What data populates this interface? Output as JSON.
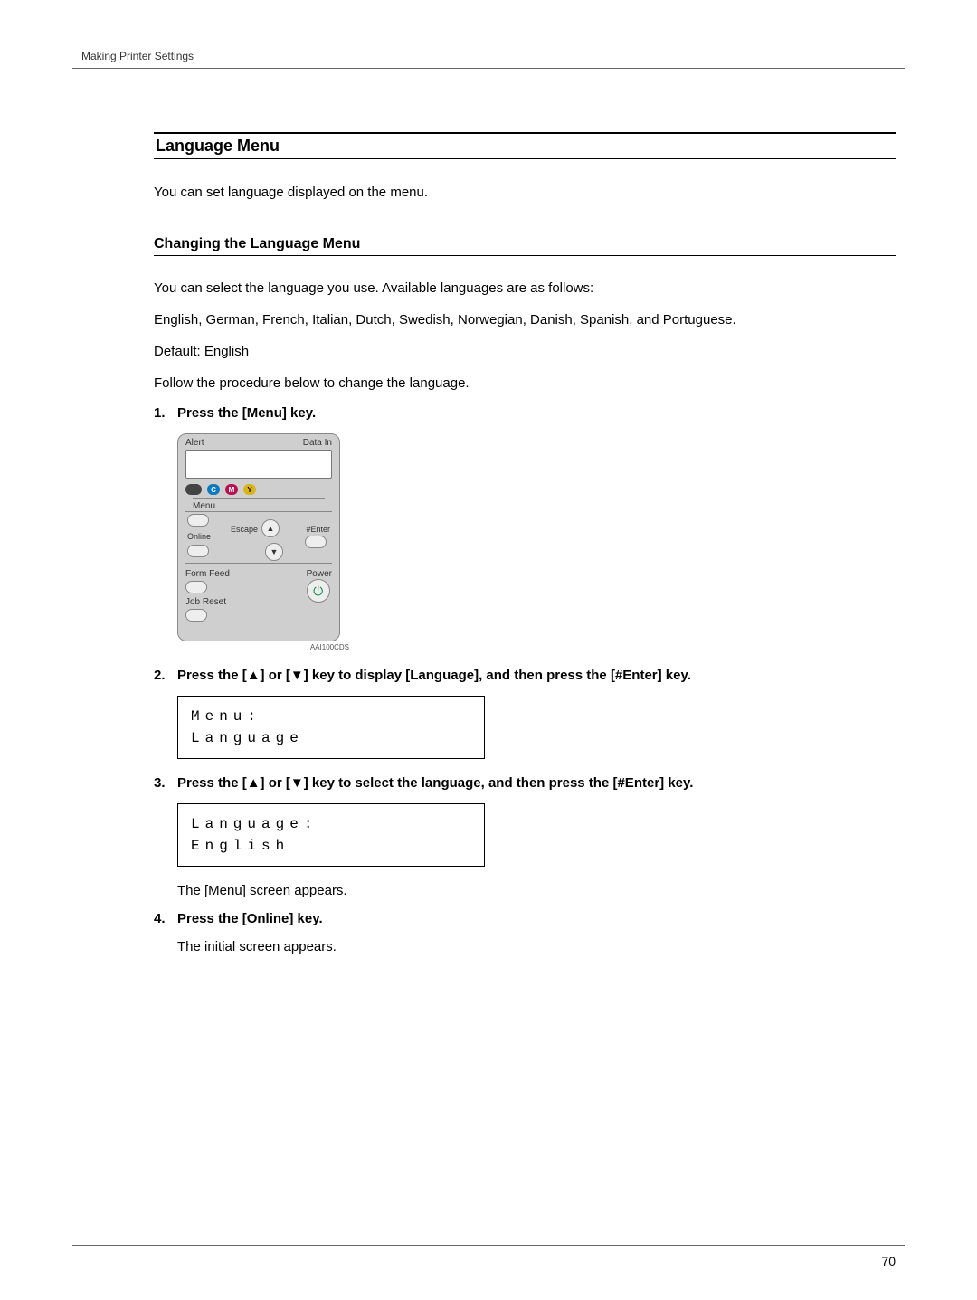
{
  "header": {
    "running": "Making Printer Settings"
  },
  "section": {
    "title": "Language Menu"
  },
  "intro": "You can set language displayed on the menu.",
  "subsection": {
    "title": "Changing the Language Menu"
  },
  "paragraphs": {
    "p1": "You can select the language you use. Available languages are as follows:",
    "p2": "English, German, French, Italian, Dutch, Swedish, Norwegian, Danish, Spanish, and Portuguese.",
    "p3": "Default: English",
    "p4": "Follow the procedure below to change the language."
  },
  "steps": {
    "s1_num": "1.",
    "s1": "Press the [Menu] key.",
    "s2_num": "2.",
    "s2": "Press the [▲] or [▼] key to display [Language], and then press the [#Enter] key.",
    "s3_num": "3.",
    "s3": "Press the [▲] or [▼] key to select the language, and then press the [#Enter] key.",
    "s3_note": "The [Menu] screen appears.",
    "s4_num": "4.",
    "s4": "Press the [Online] key.",
    "s4_note": "The initial screen appears."
  },
  "panel": {
    "alert": "Alert",
    "datain": "Data In",
    "toner": {
      "c": "C",
      "m": "M",
      "y": "Y"
    },
    "menu": "Menu",
    "escape": "Escape",
    "enter": "#Enter",
    "online": "Online",
    "formfeed": "Form Feed",
    "power": "Power",
    "jobreset": "Job Reset",
    "figcode": "AAI100CDS"
  },
  "lcd1": {
    "line1": "Menu:",
    "line2": "Language"
  },
  "lcd2": {
    "line1": "Language:",
    "line2": "English"
  },
  "page_number": "70"
}
